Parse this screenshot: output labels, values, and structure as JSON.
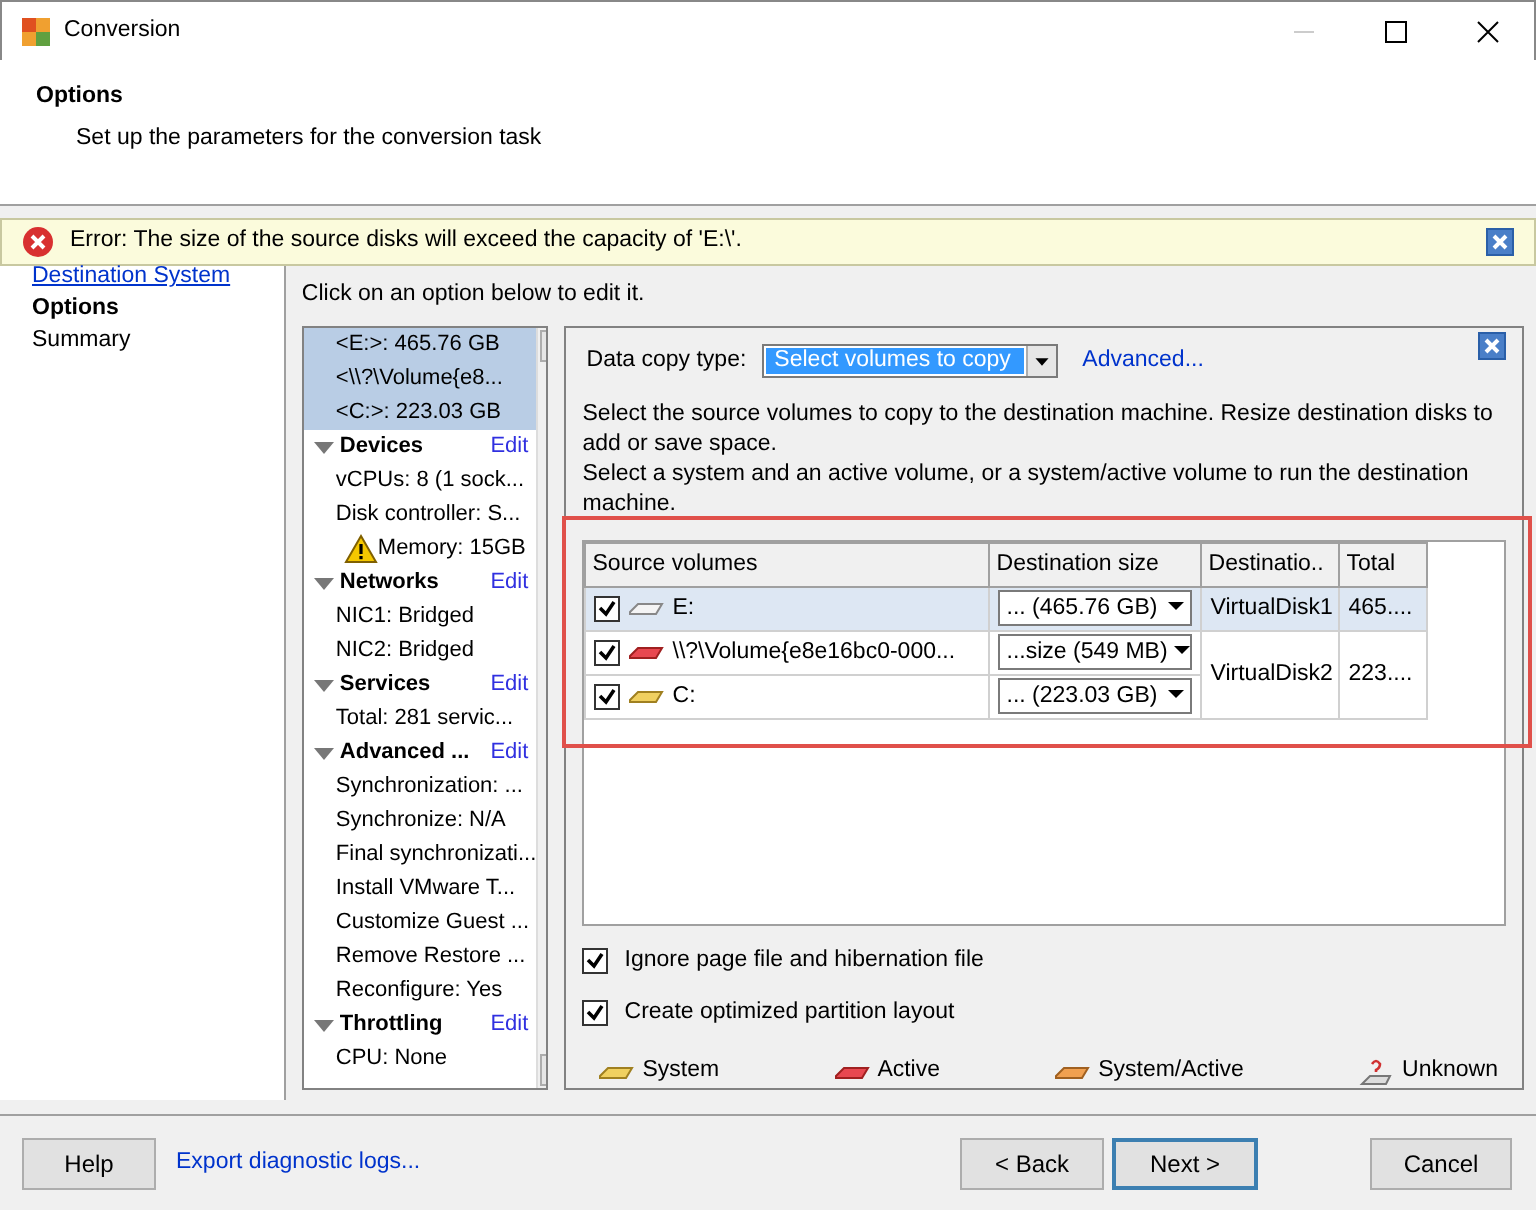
{
  "window": {
    "title": "Conversion"
  },
  "header": {
    "title": "Options",
    "subtitle": "Set up the parameters for the conversion task"
  },
  "error": {
    "message": "Error: The size of the source disks will exceed the capacity of 'E:\\'."
  },
  "steps": [
    {
      "label": "Destination System",
      "kind": "link"
    },
    {
      "label": "Options",
      "kind": "current"
    },
    {
      "label": "Summary",
      "kind": "pending"
    }
  ],
  "options_hint": "Click on an option below to edit it.",
  "option_list": [
    {
      "kind": "entry",
      "label": "<E:>: 465.76 GB",
      "selected": true
    },
    {
      "kind": "entry",
      "label": "<\\\\?\\Volume{e8...",
      "selected": true
    },
    {
      "kind": "entry",
      "label": "<C:>: 223.03 GB",
      "selected": true
    },
    {
      "kind": "section",
      "label": "Devices",
      "expanded": true,
      "action": "Edit"
    },
    {
      "kind": "entry",
      "label": "vCPUs: 8 (1 sock...",
      "selected": false
    },
    {
      "kind": "entry",
      "label": "Disk controller: S...",
      "selected": false
    },
    {
      "kind": "warning",
      "label": "Memory: 15GB",
      "selected": false
    },
    {
      "kind": "section",
      "label": "Networks",
      "expanded": true,
      "action": "Edit"
    },
    {
      "kind": "entry",
      "label": "NIC1: Bridged",
      "selected": false
    },
    {
      "kind": "entry",
      "label": "NIC2: Bridged",
      "selected": false
    },
    {
      "kind": "section",
      "label": "Services",
      "expanded": true,
      "action": "Edit"
    },
    {
      "kind": "entry",
      "label": "Total: 281 servic...",
      "selected": false
    },
    {
      "kind": "section",
      "label": "Advanced ...",
      "expanded": true,
      "action": "Edit"
    },
    {
      "kind": "entry",
      "label": "Synchronization: ...",
      "selected": false
    },
    {
      "kind": "entry",
      "label": "Synchronize: N/A",
      "selected": false
    },
    {
      "kind": "entry",
      "label": "Final synchronizati...",
      "selected": false
    },
    {
      "kind": "entry",
      "label": "Install VMware T...",
      "selected": false
    },
    {
      "kind": "entry",
      "label": "Customize Guest ...",
      "selected": false
    },
    {
      "kind": "entry",
      "label": "Remove Restore ...",
      "selected": false
    },
    {
      "kind": "entry",
      "label": "Reconfigure: Yes",
      "selected": false
    },
    {
      "kind": "section",
      "label": "Throttling",
      "expanded": true,
      "action": "Edit"
    },
    {
      "kind": "entry",
      "label": "CPU: None",
      "selected": false
    }
  ],
  "copy_panel": {
    "type_label": "Data copy type:",
    "type_value": "Select volumes to copy",
    "advanced": "Advanced...",
    "description": [
      "Select the source volumes to copy to the destination machine. Resize destination disks to add or save space.",
      "Select a system and an active volume, or a system/active volume to run the destination machine."
    ],
    "columns": [
      "Source volumes",
      "Destination size",
      "Destinatio..",
      "Total"
    ],
    "rows": [
      {
        "checked": true,
        "kind": "plain",
        "name": "E:",
        "size": "... (465.76 GB)",
        "disk": "VirtualDisk1",
        "total": "465....",
        "selected": true
      },
      {
        "checked": true,
        "kind": "active",
        "name": "\\\\?\\Volume{e8e16bc0-000...",
        "size": "...size (549 MB)",
        "disk": "VirtualDisk2",
        "total": "223....",
        "selected": false
      },
      {
        "checked": true,
        "kind": "system",
        "name": "C:",
        "size": "... (223.03 GB)",
        "selected": false
      }
    ],
    "options": [
      {
        "label": "Ignore page file and hibernation file",
        "checked": true
      },
      {
        "label": "Create optimized partition layout",
        "checked": true
      }
    ],
    "legend": [
      {
        "kind": "system",
        "label": "System"
      },
      {
        "kind": "active",
        "label": "Active"
      },
      {
        "kind": "system_active",
        "label": "System/Active"
      },
      {
        "kind": "unknown",
        "label": "Unknown"
      }
    ]
  },
  "footer": {
    "help": "Help",
    "export": "Export diagnostic logs...",
    "back": "< Back",
    "next": "Next >",
    "cancel": "Cancel"
  }
}
